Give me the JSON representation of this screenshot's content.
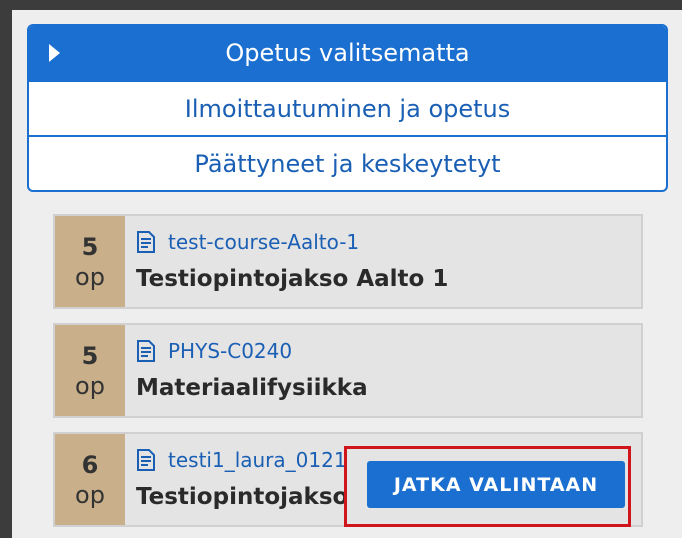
{
  "tabs": [
    {
      "label": "Opetus valitsematta",
      "active": true
    },
    {
      "label": "Ilmoittautuminen ja opetus",
      "active": false
    },
    {
      "label": "Päättyneet ja keskeytetyt",
      "active": false
    }
  ],
  "courses": [
    {
      "credits": "5",
      "unit": "op",
      "code": "test-course-Aalto-1",
      "name": "Testiopintojakso Aalto 1"
    },
    {
      "credits": "5",
      "unit": "op",
      "code": "PHYS-C0240",
      "name": "Materiaalifysiikka"
    },
    {
      "credits": "6",
      "unit": "op",
      "code": "testi1_laura_0121",
      "name": "Testiopintojakso"
    }
  ],
  "continue_button": {
    "label": "JATKA VALINTAAN"
  },
  "colors": {
    "accent": "#1a6fd0",
    "credits_bg": "#c9b08a",
    "highlight": "#d0141c"
  }
}
